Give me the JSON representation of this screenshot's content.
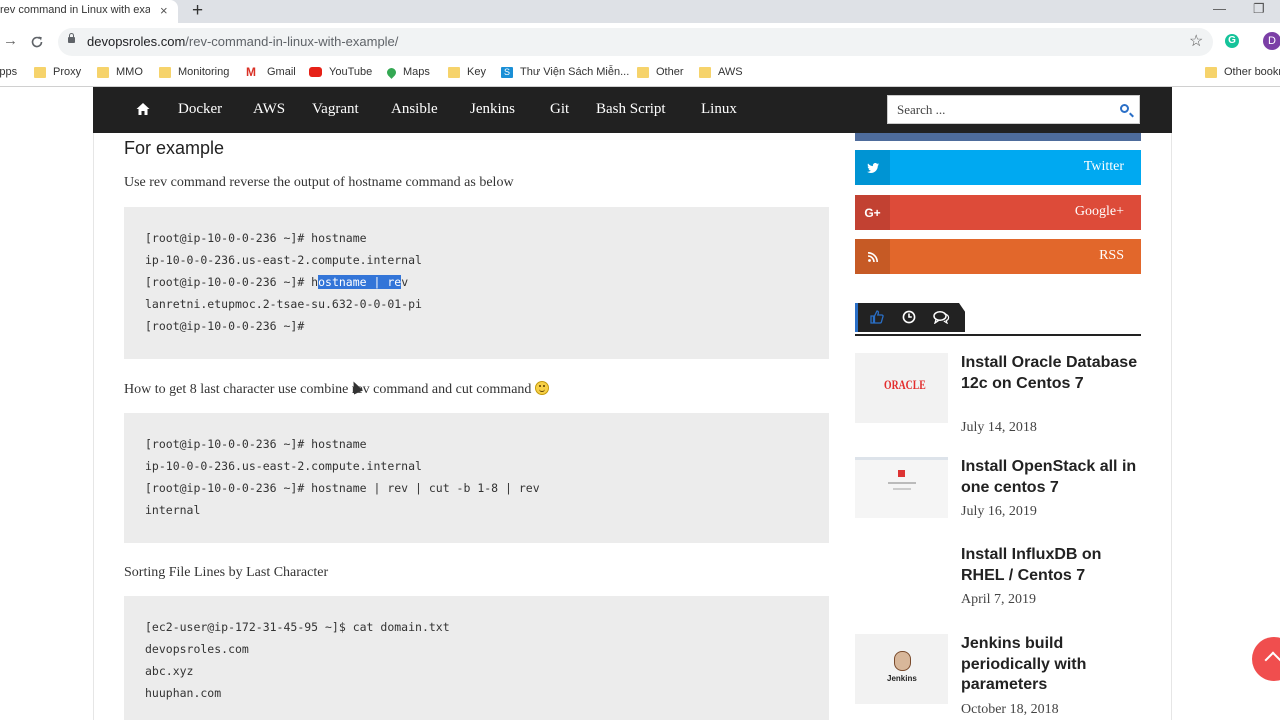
{
  "browser": {
    "tab_title": "rev command in Linux with example",
    "new_tab": "+",
    "close": "×",
    "url_host": "devopsroles.com",
    "url_path": "/rev-command-in-linux-with-example/",
    "profile_initial": "D",
    "extension": "G",
    "minimize": "—",
    "restore": "❐",
    "bookmarks": [
      {
        "label": "Apps",
        "icon": "apps-icon"
      },
      {
        "label": "Proxy",
        "icon": "folder-icon"
      },
      {
        "label": "MMO",
        "icon": "folder-icon"
      },
      {
        "label": "Monitoring",
        "icon": "folder-icon"
      },
      {
        "label": "Gmail",
        "icon": "gmail-icon"
      },
      {
        "label": "YouTube",
        "icon": "youtube-icon"
      },
      {
        "label": "Maps",
        "icon": "maps-icon"
      },
      {
        "label": "Key",
        "icon": "folder-icon"
      },
      {
        "label": "Thư Viện Sách Miễn...",
        "icon": "s-icon"
      },
      {
        "label": "Other",
        "icon": "folder-icon"
      },
      {
        "label": "AWS",
        "icon": "folder-icon"
      },
      {
        "label": "Other bookmarks",
        "icon": "folder-icon"
      }
    ]
  },
  "nav": {
    "items": [
      "Docker",
      "AWS",
      "Vagrant",
      "Ansible",
      "Jenkins",
      "Git",
      "Bash Script",
      "Linux"
    ],
    "search_placeholder": "Search ..."
  },
  "article": {
    "heading": "For example",
    "para1": "Use rev command reverse the output of hostname command as below",
    "code1": [
      "[root@ip-10-0-0-236 ~]# hostname",
      "ip-10-0-0-236.us-east-2.compute.internal",
      "[root@ip-10-0-0-236 ~]# h",
      "lanretni.etupmoc.2-tsae-su.632-0-0-01-pi",
      "[root@ip-10-0-0-236 ~]#"
    ],
    "code1_selected": "ostname | re",
    "code1_after_selected": "v",
    "para2": "How to get 8 last character use combine rev command and cut command",
    "code2": [
      "[root@ip-10-0-0-236 ~]# hostname",
      "ip-10-0-0-236.us-east-2.compute.internal",
      "[root@ip-10-0-0-236 ~]# hostname | rev | cut -b 1-8 | rev",
      "internal"
    ],
    "para3": "Sorting File Lines by Last Character",
    "code3": [
      "[ec2-user@ip-172-31-45-95 ~]$ cat domain.txt",
      "devopsroles.com",
      "abc.xyz",
      "huuphan.com"
    ]
  },
  "sidebar": {
    "social": [
      {
        "label": "Twitter",
        "icon": "twitter-icon",
        "color": "#00a9f1"
      },
      {
        "label": "Google+",
        "icon": "google-plus-icon",
        "color": "#dd4b39"
      },
      {
        "label": "RSS",
        "icon": "rss-icon",
        "color": "#e2672b"
      }
    ],
    "posts": [
      {
        "title": "Install Oracle Database 12c on Centos 7",
        "date": "July 14, 2018",
        "thumb_text": "ORACLE"
      },
      {
        "title": "Install OpenStack all in one centos 7",
        "date": "July 16, 2019"
      },
      {
        "title": "Install InfluxDB on RHEL / Centos 7",
        "date": "April 7, 2019"
      },
      {
        "title": "Jenkins build periodically with parameters",
        "date": "October 18, 2018",
        "thumb_text": "Jenkins"
      }
    ]
  },
  "colors": {
    "nav_bg": "#212121",
    "accent": "#2a6fc7",
    "code_bg": "#ececec",
    "selection": "#3375d8",
    "scroll_top": "#f04e4e"
  }
}
